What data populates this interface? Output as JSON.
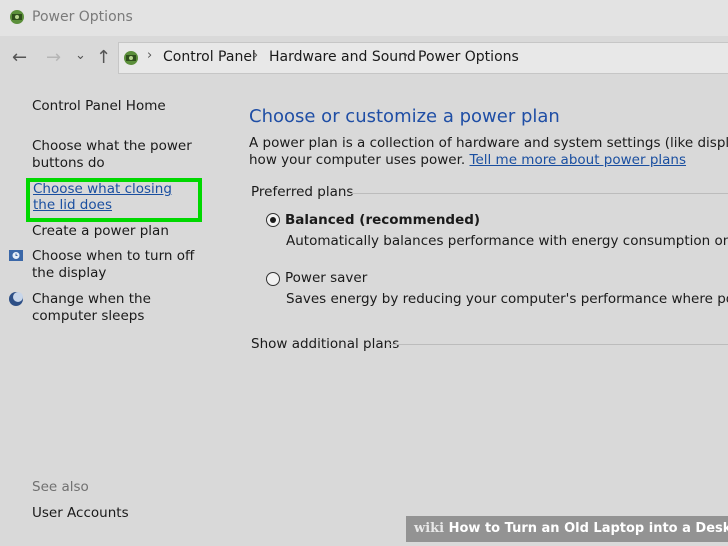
{
  "window": {
    "title": "Power Options",
    "app_icon": "power-options-icon"
  },
  "nav": {
    "back": "←",
    "forward": "→",
    "recent": "⌄",
    "up": "↑",
    "breadcrumbs": [
      "Control Panel",
      "Hardware and Sound",
      "Power Options"
    ],
    "separator": "›"
  },
  "sidebar": {
    "home": "Control Panel Home",
    "power_buttons": "Choose what the power buttons do",
    "closing_lid": "Choose what closing the lid does",
    "create_plan": "Create a power plan",
    "turn_off_display": "Choose when to turn off the display",
    "sleep": "Change when the computer sleeps",
    "see_also": "See also",
    "user_accounts": "User Accounts"
  },
  "main": {
    "heading": "Choose or customize a power plan",
    "intro_line1": "A power plan is a collection of hardware and system settings (like display brightne",
    "intro_line2": "how your computer uses power.",
    "intro_link": "Tell me more about power plans",
    "preferred_label": "Preferred plans",
    "plans": [
      {
        "name": "Balanced (recommended)",
        "desc": "Automatically balances performance with energy consumption on capable",
        "selected": true
      },
      {
        "name": "Power saver",
        "desc": "Saves energy by reducing your computer's performance where possible.",
        "selected": false
      }
    ],
    "additional_label": "Show additional plans"
  },
  "watermark": {
    "wiki": "wiki",
    "text": "How to Turn an Old Laptop into a Desktop"
  },
  "colors": {
    "highlight": "#00d800",
    "link": "#1a4fa0",
    "heading": "#1f4ea5"
  }
}
